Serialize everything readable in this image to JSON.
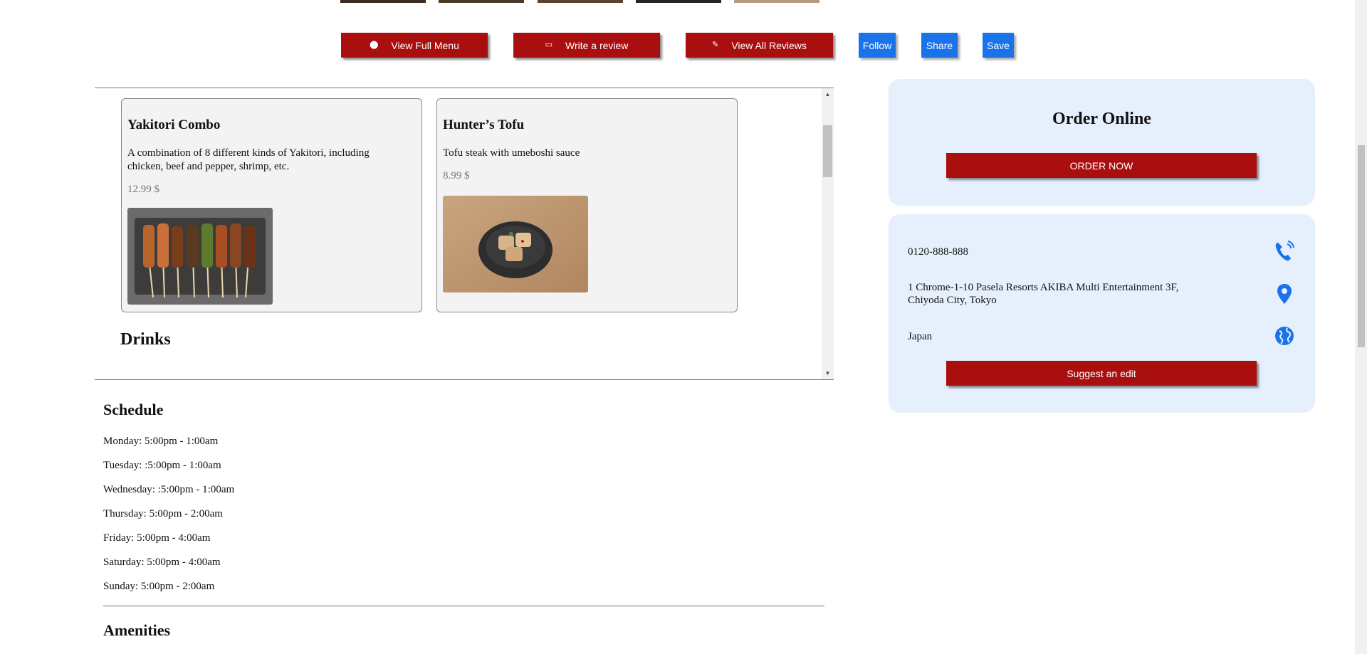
{
  "actions": {
    "view_menu": "View Full Menu",
    "write_review": "Write a review",
    "view_reviews": "View All Reviews",
    "follow": "Follow",
    "share": "Share",
    "save": "Save"
  },
  "menu": {
    "items": [
      {
        "name": "Yakitori Combo",
        "description": "A combination of 8 different kinds of Yakitori, including chicken, beef and pepper, shrimp, etc.",
        "price": "12.99 $",
        "image": "yakitori-skewers-photo"
      },
      {
        "name": "Hunter’s Tofu",
        "description": "Tofu steak with umeboshi sauce",
        "price": "8.99 $",
        "image": "tofu-bowl-photo"
      }
    ],
    "next_section": "Drinks"
  },
  "schedule": {
    "title": "Schedule",
    "days": [
      "Monday: 5:00pm - 1:00am",
      "Tuesday: :5:00pm - 1:00am",
      "Wednesday: :5:00pm - 1:00am",
      "Thursday: 5:00pm - 2:00am",
      "Friday: 5:00pm - 4:00am",
      "Saturday: 5:00pm - 4:00am",
      "Sunday: 5:00pm - 2:00am"
    ]
  },
  "amenities": {
    "title": "Amenities"
  },
  "order": {
    "title": "Order Online",
    "button": "ORDER NOW"
  },
  "contact": {
    "phone": "0120-888-888",
    "address_line1": "1 Chrome-1-10 Pasela Resorts AKIBA Multi Entertainment 3F,",
    "address_line2": "Chiyoda City, Tokyo",
    "country": "Japan",
    "suggest": "Suggest an edit",
    "icons": [
      "phone-icon",
      "map-pin-icon",
      "globe-icon"
    ]
  },
  "colors": {
    "brand_red": "#aa0f0f",
    "accent_blue": "#1a73e8",
    "panel_bg": "#e6f0fd"
  }
}
